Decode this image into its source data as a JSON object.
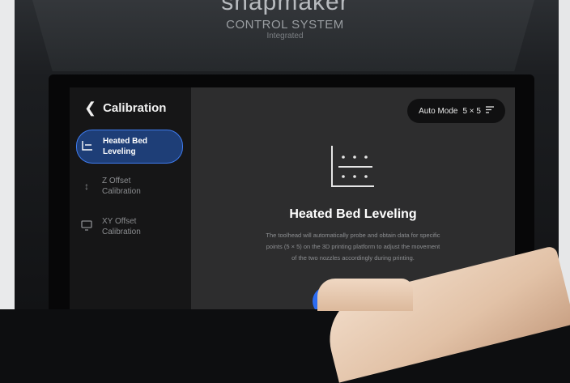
{
  "device": {
    "brand": "snapmaker",
    "subtitle": "CONTROL SYSTEM",
    "subtitle2": "Integrated"
  },
  "header": {
    "back_icon": "chevron-left-icon",
    "title": "Calibration"
  },
  "sidebar": {
    "items": [
      {
        "label_line1": "Heated Bed",
        "label_line2": "Leveling",
        "icon": "bed-leveling-icon",
        "active": true
      },
      {
        "label_line1": "Z Offset",
        "label_line2": "Calibration",
        "icon": "z-offset-icon",
        "active": false
      },
      {
        "label_line1": "XY Offset",
        "label_line2": "Calibration",
        "icon": "monitor-icon",
        "active": false
      }
    ]
  },
  "mode": {
    "label": "Auto Mode",
    "value": "5 × 5",
    "icon": "sort-icon"
  },
  "content": {
    "icon": "grid-dots-icon",
    "title": "Heated Bed Leveling",
    "description_line1": "The toolhead will automatically probe and obtain data for specific",
    "description_line2": "points (5 × 5) on the 3D printing platform to adjust the movement",
    "description_line3": "of the two nozzles accordingly during printing."
  },
  "colors": {
    "accent": "#2c6cf2",
    "active_bg": "#1e3e77",
    "screen_bg": "#2d2d2e",
    "sidebar_bg": "#161617"
  }
}
